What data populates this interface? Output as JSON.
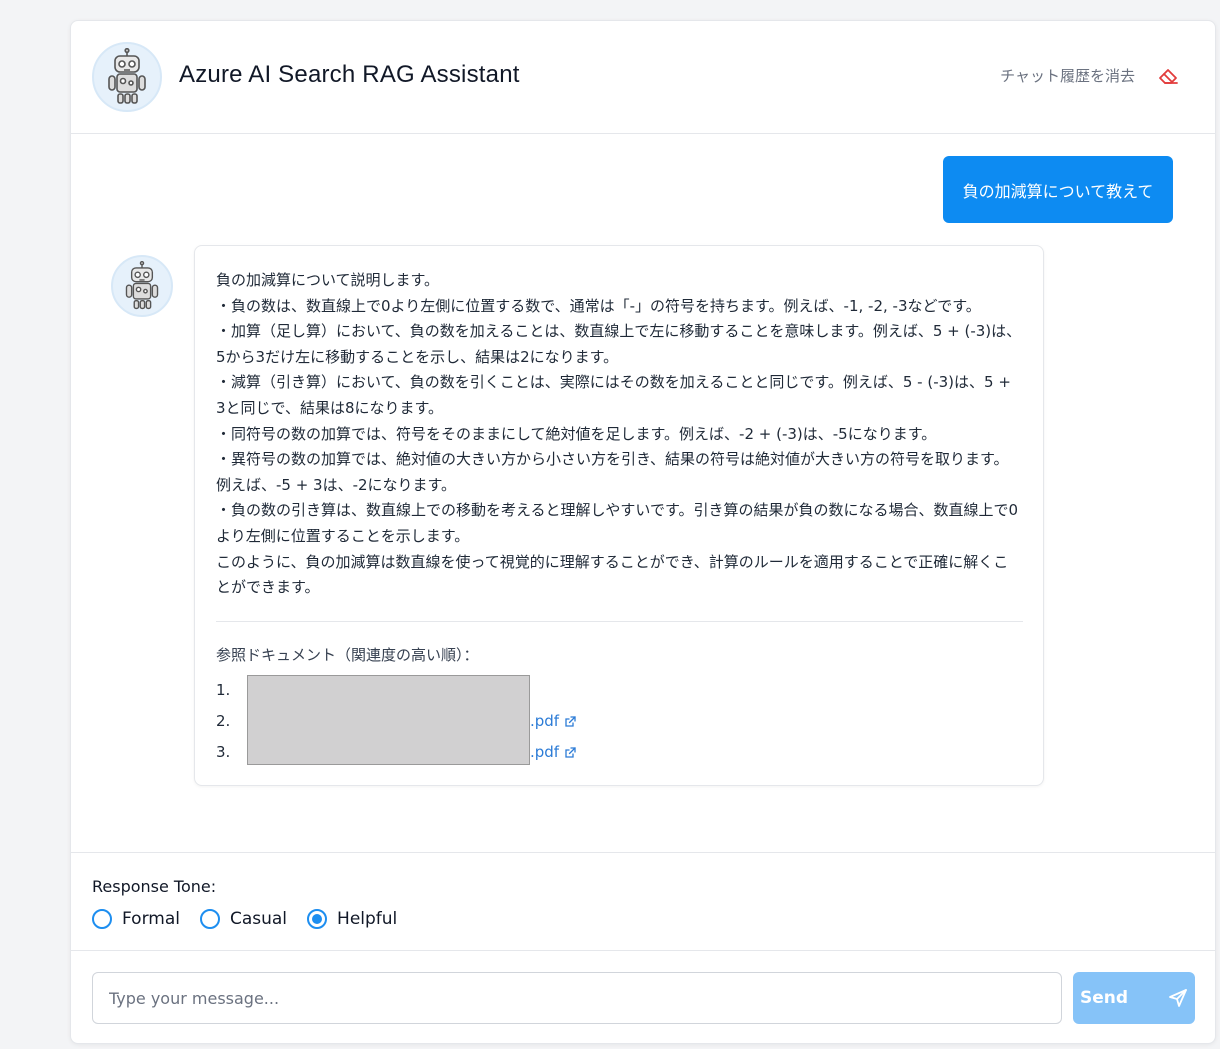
{
  "header": {
    "title": "Azure AI Search RAG Assistant",
    "clear_history_label": "チャット履歴を消去"
  },
  "conversation": {
    "user_message": "負の加減算について教えて",
    "assistant_lines": [
      "負の加減算について説明します。",
      "・負の数は、数直線上で0より左側に位置する数で、通常は「-」の符号を持ちます。例えば、-1, -2, -3などです。",
      "・加算（足し算）において、負の数を加えることは、数直線上で左に移動することを意味します。例えば、5 + (-3)は、5から3だけ左に移動することを示し、結果は2になります。",
      "・減算（引き算）において、負の数を引くことは、実際にはその数を加えることと同じです。例えば、5 - (-3)は、5 + 3と同じで、結果は8になります。",
      "・同符号の数の加算では、符号をそのままにして絶対値を足します。例えば、-2 + (-3)は、-5になります。",
      "・異符号の数の加算では、絶対値の大きい方から小さい方を引き、結果の符号は絶対値が大きい方の符号を取ります。例えば、-5 + 3は、-2になります。",
      "・負の数の引き算は、数直線上での移動を考えると理解しやすいです。引き算の結果が負の数になる場合、数直線上で0より左側に位置することを示します。",
      "このように、負の加減算は数直線を使って視覚的に理解することができ、計算のルールを適用することで正確に解くことができます。"
    ],
    "references_title": "参照ドキュメント（関連度の高い順）：",
    "references": [
      {
        "num": "1.",
        "suffix": ""
      },
      {
        "num": "2.",
        "suffix": ".pdf"
      },
      {
        "num": "3.",
        "suffix": ".pdf"
      }
    ]
  },
  "tone": {
    "label": "Response Tone:",
    "options": [
      "Formal",
      "Casual",
      "Helpful"
    ],
    "selected": "Helpful"
  },
  "input": {
    "placeholder": "Type your message...",
    "send_label": "Send"
  },
  "colors": {
    "primary": "#0d8bf2",
    "send_disabled": "#86c3f8",
    "link": "#2b7bd6",
    "eraser": "#e23c3c"
  }
}
